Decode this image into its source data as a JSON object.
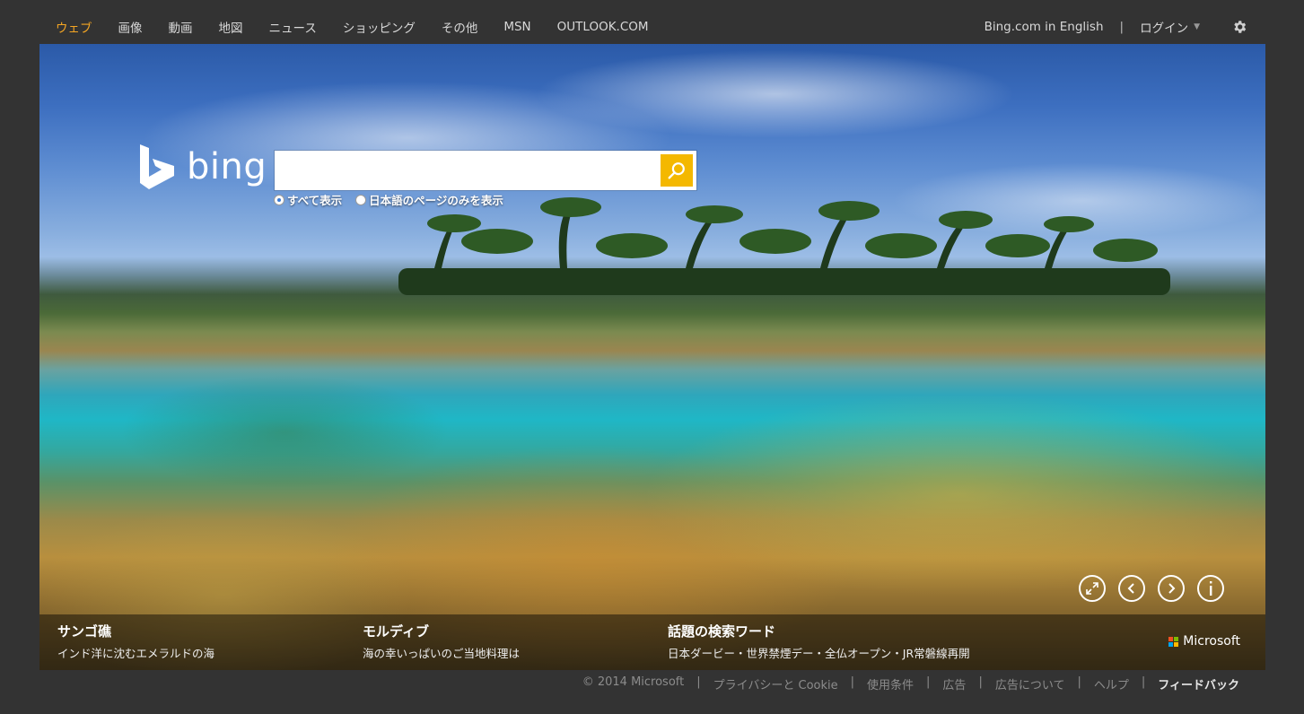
{
  "nav": {
    "items": [
      "ウェブ",
      "画像",
      "動画",
      "地図",
      "ニュース",
      "ショッピング",
      "その他",
      "MSN",
      "OUTLOOK.COM"
    ],
    "english_link": "Bing.com in English",
    "separator": "|",
    "login": "ログイン"
  },
  "logo": {
    "text": "bing"
  },
  "search": {
    "value": "",
    "options": [
      "すべて表示",
      "日本語のページのみを表示"
    ]
  },
  "stories": [
    {
      "title": "サンゴ礁",
      "subtitle": "インド洋に沈むエメラルドの海"
    },
    {
      "title": "モルディブ",
      "subtitle": "海の幸いっぱいのご当地料理は"
    },
    {
      "title": "話題の検索ワード",
      "subtitle": "日本ダービー・世界禁煙デー・全仏オープン・JR常磐線再開"
    }
  ],
  "brand": {
    "microsoft": "Microsoft"
  },
  "footer": {
    "copyright": "© 2014 Microsoft",
    "links": [
      "プライバシーと Cookie",
      "使用条件",
      "広告",
      "広告について",
      "ヘルプ"
    ],
    "feedback": "フィードバック"
  },
  "colors": {
    "accent": "#f5a623",
    "search_button": "#f4b800",
    "background": "#333333"
  }
}
